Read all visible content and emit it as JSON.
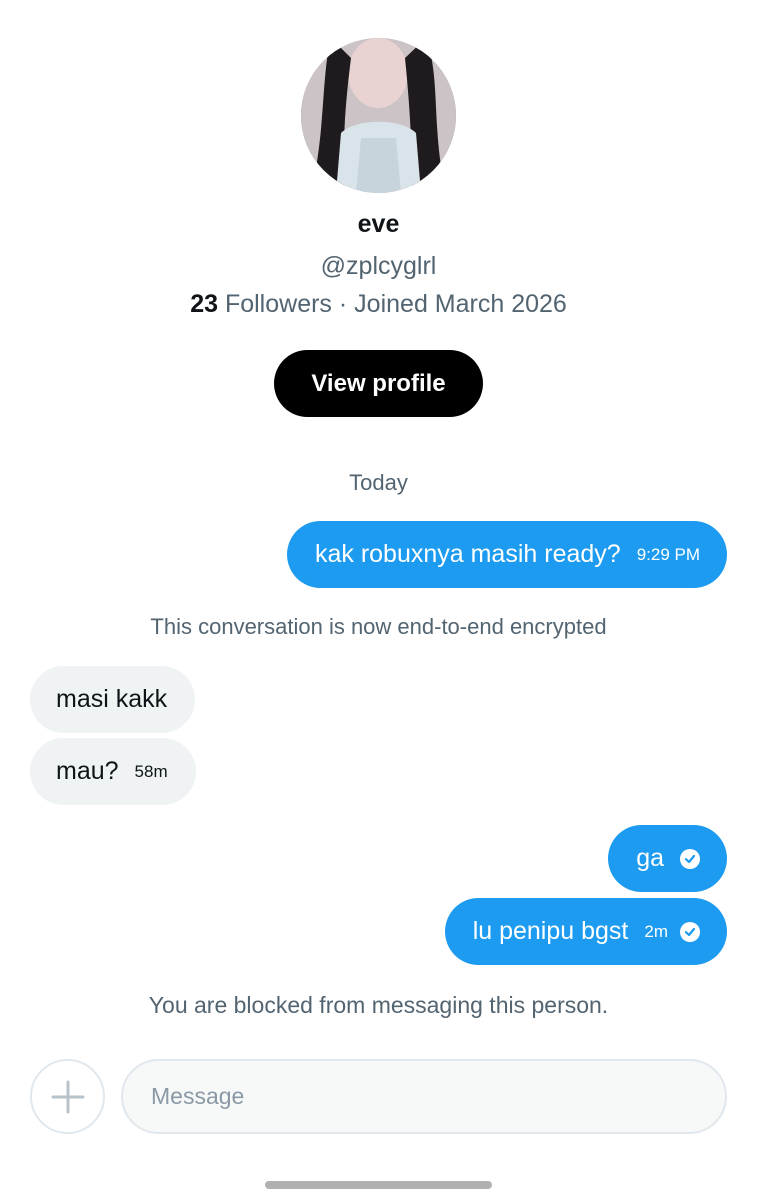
{
  "profile": {
    "name": "eve",
    "handle": "@zplcyglrl",
    "followers_count": "23",
    "followers_label": "Followers",
    "separator": "·",
    "joined": "Joined March 2026",
    "view_profile_label": "View profile"
  },
  "conversation": {
    "day_label": "Today",
    "encryption_note": "This conversation is now end-to-end encrypted",
    "blocked_note": "You are blocked from messaging this person.",
    "messages": [
      {
        "direction": "out",
        "text": "kak robuxnya masih ready?",
        "time": "9:29 PM"
      },
      {
        "direction": "in",
        "text": "masi kakk"
      },
      {
        "direction": "in",
        "text": "mau?",
        "time": "58m"
      },
      {
        "direction": "out",
        "text": "ga",
        "icon": "read-check-icon"
      },
      {
        "direction": "out",
        "text": "lu penipu bgst",
        "time": "2m",
        "icon": "read-check-icon"
      }
    ]
  },
  "composer": {
    "placeholder": "Message",
    "add_icon": "plus-icon"
  },
  "colors": {
    "accent": "#1d9bf0",
    "incoming_bubble": "#eff3f4",
    "secondary_text": "#536471",
    "button_bg": "#000000"
  }
}
